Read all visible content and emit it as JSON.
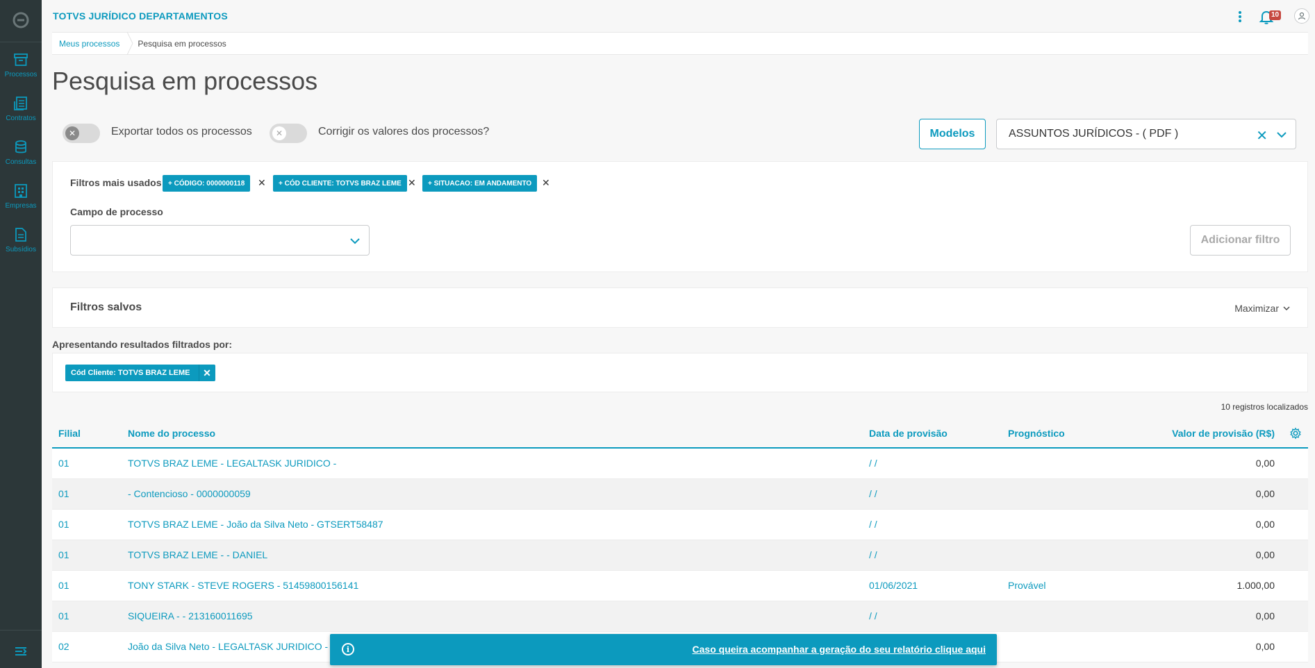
{
  "app": {
    "title": "TOTVS JURÍDICO DEPARTAMENTOS",
    "notification_count": "10"
  },
  "sidebar": {
    "items": [
      {
        "label": "Processos",
        "icon": "archive-icon"
      },
      {
        "label": "Contratos",
        "icon": "contracts-icon"
      },
      {
        "label": "Consultas",
        "icon": "database-icon"
      },
      {
        "label": "Empresas",
        "icon": "building-icon"
      },
      {
        "label": "Subsídios",
        "icon": "document-icon"
      }
    ]
  },
  "breadcrumb": {
    "parent": "Meus processos",
    "current": "Pesquisa em processos"
  },
  "page": {
    "title": "Pesquisa em processos"
  },
  "options": {
    "export_all_label": "Exportar todos os processos",
    "correct_values_label": "Corrigir os valores dos processos?",
    "modelos_label": "Modelos",
    "model_selected": "ASSUNTOS JURÍDICOS - ( PDF )"
  },
  "filters": {
    "most_used_label": "Filtros mais usados",
    "tags": [
      "+ CÓDIGO: 0000000118",
      "+ CÓD CLIENTE: TOTVS BRAZ LEME",
      "+ SITUACAO: EM ANDAMENTO"
    ],
    "campo_label": "Campo de processo",
    "add_filter_label": "Adicionar filtro"
  },
  "saved": {
    "title": "Filtros salvos",
    "maximize_label": "Maximizar"
  },
  "results": {
    "label": "Apresentando resultados filtrados por:",
    "chip": "Cód Cliente: TOTVS BRAZ LEME",
    "records": "10 registros localizados"
  },
  "table": {
    "headers": {
      "filial": "Filial",
      "nome": "Nome do processo",
      "data": "Data de provisão",
      "prog": "Prognóstico",
      "valor": "Valor de provisão (R$)"
    },
    "rows": [
      {
        "filial": "01",
        "nome": "TOTVS BRAZ LEME - LEGALTASK JURIDICO -",
        "data": "/ /",
        "prog": "",
        "valor": "0,00"
      },
      {
        "filial": "01",
        "nome": "- Contencioso - 0000000059",
        "data": "/ /",
        "prog": "",
        "valor": "0,00"
      },
      {
        "filial": "01",
        "nome": "TOTVS BRAZ LEME - João da Silva Neto - GTSERT58487",
        "data": "/ /",
        "prog": "",
        "valor": "0,00"
      },
      {
        "filial": "01",
        "nome": "TOTVS BRAZ LEME - - DANIEL",
        "data": "/ /",
        "prog": "",
        "valor": "0,00"
      },
      {
        "filial": "01",
        "nome": "TONY STARK - STEVE ROGERS - 51459800156141",
        "data": "01/06/2021",
        "prog": "Provável",
        "valor": "1.000,00"
      },
      {
        "filial": "01",
        "nome": "SIQUEIRA - - 213160011695",
        "data": "/ /",
        "prog": "",
        "valor": "0,00"
      },
      {
        "filial": "02",
        "nome": "João da Silva Neto - LEGALTASK JURIDICO - 5",
        "data": "",
        "prog": "",
        "valor": "0,00"
      }
    ]
  },
  "toast": {
    "message": "Caso queira acompanhar a geração do seu relatório clique aqui"
  },
  "colors": {
    "primary": "#0c9abe",
    "sidebar": "#2c3739",
    "badge": "#c64840"
  }
}
